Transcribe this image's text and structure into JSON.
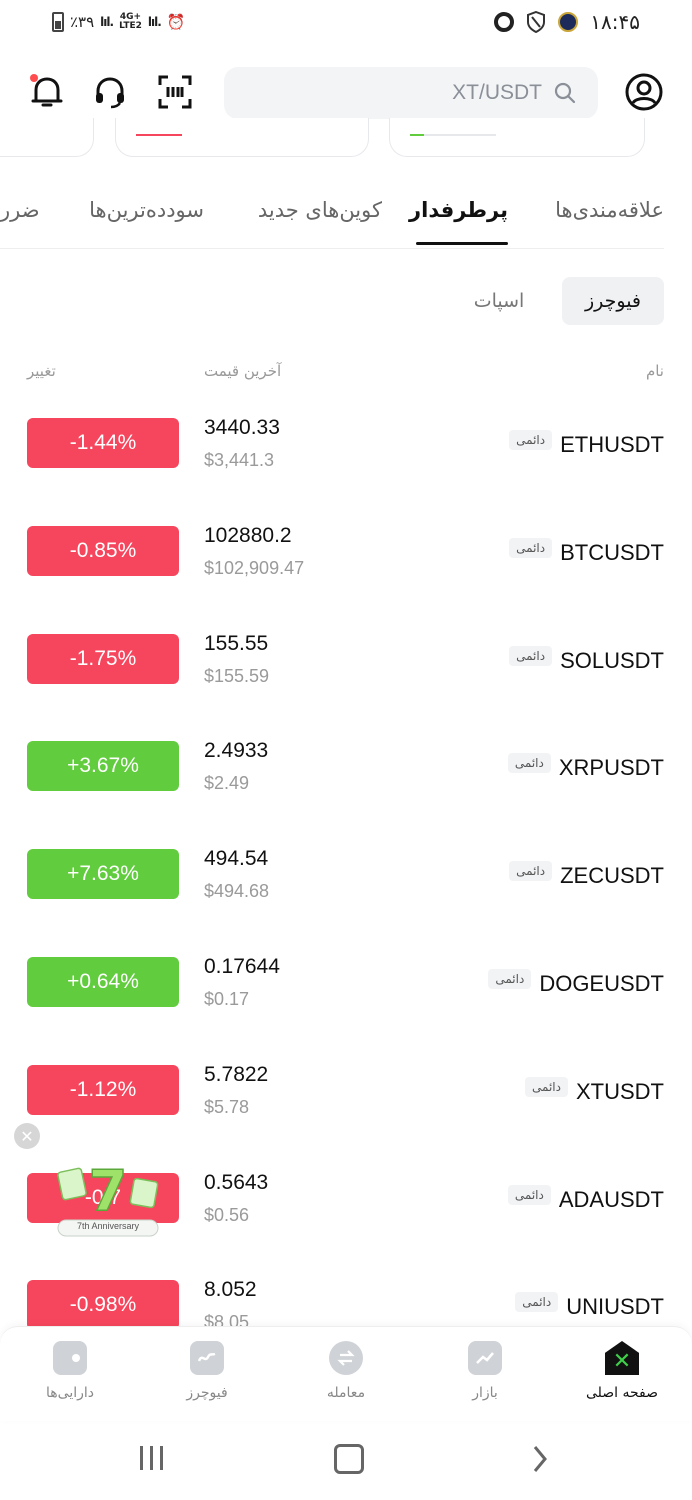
{
  "status_bar": {
    "battery": "٪۳۹",
    "network": "4G+ LTE2",
    "time": "۱۸:۴۵"
  },
  "search": {
    "placeholder": "XT/USDT"
  },
  "tabs": [
    "علاقه‌مندی‌ها",
    "پرطرفدار",
    "کوین‌های جدید",
    "سودده‌ترین‌ها",
    "ضرر"
  ],
  "active_tab": "پرطرفدار",
  "subtabs": {
    "futures": "فیوچرز",
    "spot": "اسپات"
  },
  "columns": {
    "name": "نام",
    "last_price": "آخرین قیمت",
    "change": "تغییر"
  },
  "perpetual_label": "دائمی",
  "rows": [
    {
      "symbol": "ETHUSDT",
      "price": "3440.33",
      "usd": "$3,441.3",
      "change": "-1.44%",
      "dir": "neg"
    },
    {
      "symbol": "BTCUSDT",
      "price": "102880.2",
      "usd": "$102,909.47",
      "change": "-0.85%",
      "dir": "neg"
    },
    {
      "symbol": "SOLUSDT",
      "price": "155.55",
      "usd": "$155.59",
      "change": "-1.75%",
      "dir": "neg"
    },
    {
      "symbol": "XRPUSDT",
      "price": "2.4933",
      "usd": "$2.49",
      "change": "+3.67%",
      "dir": "pos"
    },
    {
      "symbol": "ZECUSDT",
      "price": "494.54",
      "usd": "$494.68",
      "change": "+7.63%",
      "dir": "pos"
    },
    {
      "symbol": "DOGEUSDT",
      "price": "0.17644",
      "usd": "$0.17",
      "change": "+0.64%",
      "dir": "pos"
    },
    {
      "symbol": "XTUSDT",
      "price": "5.7822",
      "usd": "$5.78",
      "change": "-1.12%",
      "dir": "neg"
    },
    {
      "symbol": "ADAUSDT",
      "price": "0.5643",
      "usd": "$0.56",
      "change": "-0.7",
      "dir": "neg"
    },
    {
      "symbol": "UNIUSDT",
      "price": "8.052",
      "usd": "$8.05",
      "change": "-0.98%",
      "dir": "neg"
    }
  ],
  "anniversary": {
    "number": "7",
    "text": "7th Anniversary"
  },
  "bottom_nav": [
    {
      "label": "صفحه اصلی",
      "icon": "home-x-icon",
      "active": true
    },
    {
      "label": "بازار",
      "icon": "market-chart-icon",
      "active": false
    },
    {
      "label": "معامله",
      "icon": "trade-swap-icon",
      "active": false
    },
    {
      "label": "فیوچرز",
      "icon": "futures-icon",
      "active": false
    },
    {
      "label": "دارایی‌ها",
      "icon": "wallet-icon",
      "active": false
    }
  ],
  "colors": {
    "negative": "#f6465d",
    "positive": "#61cc3d",
    "brand_green": "#3fd14a"
  }
}
